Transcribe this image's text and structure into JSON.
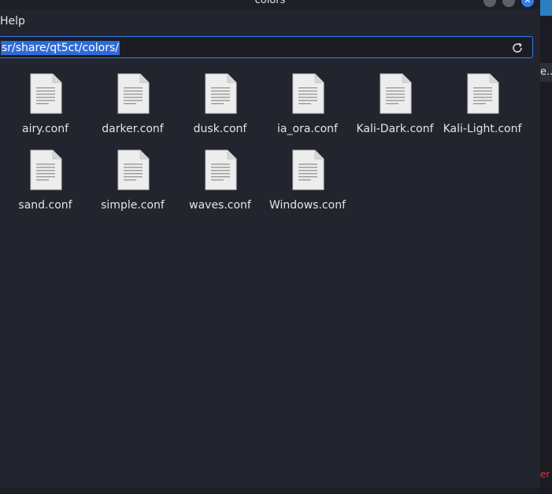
{
  "window": {
    "title": "colors"
  },
  "menu": {
    "help": "Help"
  },
  "location": {
    "path": "sr/share/qt5ct/colors/"
  },
  "files": [
    {
      "name": "airy.conf"
    },
    {
      "name": "darker.conf"
    },
    {
      "name": "dusk.conf"
    },
    {
      "name": "ia_ora.conf"
    },
    {
      "name": "Kali-Dark.conf"
    },
    {
      "name": "Kali-Light.conf"
    },
    {
      "name": "sand.conf"
    },
    {
      "name": "simple.conf"
    },
    {
      "name": "waves.conf"
    },
    {
      "name": "Windows.conf"
    }
  ],
  "background_window": {
    "tab_text": "e...",
    "red_text": "er"
  },
  "colors": {
    "accent": "#367bf0",
    "background": "#23252e",
    "text": "#e3e4e8"
  },
  "icons": {
    "file": "text-file-icon",
    "reload": "reload-icon"
  }
}
